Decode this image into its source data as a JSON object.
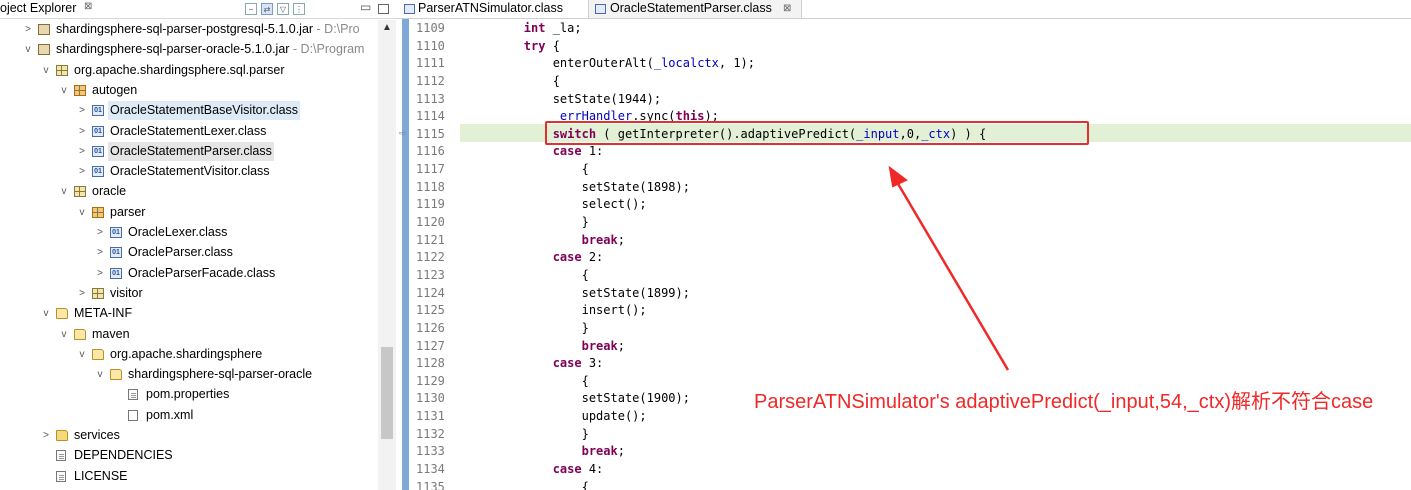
{
  "project_explorer": {
    "title": "oject Explorer",
    "close": "⊠",
    "toolbar": [
      "collapse-all",
      "link-with-editor",
      "filter",
      "view-menu"
    ],
    "tree": [
      {
        "label": "shardingsphere-sql-parser-postgresql-5.1.0.jar",
        "decoration": " - D:\\Pro",
        "icon": "jar-icon",
        "twisty": ">",
        "indent": 0
      },
      {
        "label": "shardingsphere-sql-parser-oracle-5.1.0.jar",
        "decoration": " - D:\\Program",
        "icon": "jar-icon",
        "twisty": "v",
        "indent": 0
      },
      {
        "label": "org.apache.shardingsphere.sql.parser",
        "decoration": "",
        "icon": "package-icon",
        "twisty": "v",
        "indent": 1
      },
      {
        "label": "autogen",
        "decoration": "",
        "icon": "package-brown-icon",
        "twisty": "v",
        "indent": 2
      },
      {
        "label": "OracleStatementBaseVisitor.class",
        "decoration": "",
        "icon": "class-file-icon",
        "twisty": ">",
        "indent": 3,
        "state": "hover"
      },
      {
        "label": "OracleStatementLexer.class",
        "decoration": "",
        "icon": "class-file-icon",
        "twisty": ">",
        "indent": 3
      },
      {
        "label": "OracleStatementParser.class",
        "decoration": "",
        "icon": "class-file-icon",
        "twisty": ">",
        "indent": 3,
        "state": "selected"
      },
      {
        "label": "OracleStatementVisitor.class",
        "decoration": "",
        "icon": "class-file-icon",
        "twisty": ">",
        "indent": 3
      },
      {
        "label": "oracle",
        "decoration": "",
        "icon": "package-icon",
        "twisty": "v",
        "indent": 2
      },
      {
        "label": "parser",
        "decoration": "",
        "icon": "package-brown-icon",
        "twisty": "v",
        "indent": 3
      },
      {
        "label": "OracleLexer.class",
        "decoration": "",
        "icon": "class-file-icon",
        "twisty": ">",
        "indent": 4
      },
      {
        "label": "OracleParser.class",
        "decoration": "",
        "icon": "class-file-icon",
        "twisty": ">",
        "indent": 4
      },
      {
        "label": "OracleParserFacade.class",
        "decoration": "",
        "icon": "class-file-icon",
        "twisty": ">",
        "indent": 4
      },
      {
        "label": "visitor",
        "decoration": "",
        "icon": "package-icon",
        "twisty": ">",
        "indent": 3
      },
      {
        "label": "META-INF",
        "decoration": "",
        "icon": "folder-open-icon",
        "twisty": "v",
        "indent": 1
      },
      {
        "label": "maven",
        "decoration": "",
        "icon": "folder-open-icon",
        "twisty": "v",
        "indent": 2
      },
      {
        "label": "org.apache.shardingsphere",
        "decoration": "",
        "icon": "folder-open-icon",
        "twisty": "v",
        "indent": 3
      },
      {
        "label": "shardingsphere-sql-parser-oracle",
        "decoration": "",
        "icon": "folder-open-icon",
        "twisty": "v",
        "indent": 4
      },
      {
        "label": "pom.properties",
        "decoration": "",
        "icon": "file-icon",
        "twisty": "",
        "indent": 5
      },
      {
        "label": "pom.xml",
        "decoration": "",
        "icon": "xml-file-icon",
        "twisty": "",
        "indent": 5
      },
      {
        "label": "services",
        "decoration": "",
        "icon": "folder-icon",
        "twisty": ">",
        "indent": 1
      },
      {
        "label": "DEPENDENCIES",
        "decoration": "",
        "icon": "file-icon",
        "twisty": "",
        "indent": 1
      },
      {
        "label": "LICENSE",
        "decoration": "",
        "icon": "file-icon",
        "twisty": "",
        "indent": 1
      }
    ]
  },
  "editor": {
    "tabs": [
      {
        "label": "ParserATNSimulator.class",
        "active": false
      },
      {
        "label": "OracleStatementParser.class",
        "active": true,
        "close": "⊠"
      }
    ],
    "current_line": "1115",
    "lines": [
      {
        "n": "1109",
        "code": [
          [
            "        ",
            ""
          ],
          [
            "int",
            "kw"
          ],
          [
            " _la;",
            ""
          ]
        ]
      },
      {
        "n": "1110",
        "code": [
          [
            "        ",
            ""
          ],
          [
            "try",
            "kw"
          ],
          [
            " {",
            ""
          ]
        ]
      },
      {
        "n": "1111",
        "code": [
          [
            "            enterOuterAlt(",
            ""
          ],
          [
            "_localctx",
            "fld"
          ],
          [
            ", 1);",
            ""
          ]
        ]
      },
      {
        "n": "1112",
        "code": [
          [
            "            {",
            ""
          ]
        ]
      },
      {
        "n": "1113",
        "code": [
          [
            "            setState(1944);",
            ""
          ]
        ]
      },
      {
        "n": "1114",
        "code": [
          [
            "            ",
            ""
          ],
          [
            "_errHandler",
            "fld"
          ],
          [
            ".sync(",
            ""
          ],
          [
            "this",
            "kw"
          ],
          [
            ");",
            ""
          ]
        ]
      },
      {
        "n": "1115",
        "code": [
          [
            "            ",
            ""
          ],
          [
            "switch",
            "kw"
          ],
          [
            " ( getInterpreter().adaptivePredict(",
            ""
          ],
          [
            "_input",
            "fld"
          ],
          [
            ",0,",
            ""
          ],
          [
            "_ctx",
            "fld"
          ],
          [
            ") ) {",
            ""
          ]
        ]
      },
      {
        "n": "1116",
        "code": [
          [
            "            ",
            ""
          ],
          [
            "case",
            "kw"
          ],
          [
            " 1:",
            ""
          ]
        ]
      },
      {
        "n": "1117",
        "code": [
          [
            "                {",
            ""
          ]
        ]
      },
      {
        "n": "1118",
        "code": [
          [
            "                setState(1898);",
            ""
          ]
        ]
      },
      {
        "n": "1119",
        "code": [
          [
            "                select();",
            ""
          ]
        ]
      },
      {
        "n": "1120",
        "code": [
          [
            "                }",
            ""
          ]
        ]
      },
      {
        "n": "1121",
        "code": [
          [
            "                ",
            ""
          ],
          [
            "break",
            "kw"
          ],
          [
            ";",
            ""
          ]
        ]
      },
      {
        "n": "1122",
        "code": [
          [
            "            ",
            ""
          ],
          [
            "case",
            "kw"
          ],
          [
            " 2:",
            ""
          ]
        ]
      },
      {
        "n": "1123",
        "code": [
          [
            "                {",
            ""
          ]
        ]
      },
      {
        "n": "1124",
        "code": [
          [
            "                setState(1899);",
            ""
          ]
        ]
      },
      {
        "n": "1125",
        "code": [
          [
            "                insert();",
            ""
          ]
        ]
      },
      {
        "n": "1126",
        "code": [
          [
            "                }",
            ""
          ]
        ]
      },
      {
        "n": "1127",
        "code": [
          [
            "                ",
            ""
          ],
          [
            "break",
            "kw"
          ],
          [
            ";",
            ""
          ]
        ]
      },
      {
        "n": "1128",
        "code": [
          [
            "            ",
            ""
          ],
          [
            "case",
            "kw"
          ],
          [
            " 3:",
            ""
          ]
        ]
      },
      {
        "n": "1129",
        "code": [
          [
            "                {",
            ""
          ]
        ]
      },
      {
        "n": "1130",
        "code": [
          [
            "                setState(1900);",
            ""
          ]
        ]
      },
      {
        "n": "1131",
        "code": [
          [
            "                update();",
            ""
          ]
        ]
      },
      {
        "n": "1132",
        "code": [
          [
            "                }",
            ""
          ]
        ]
      },
      {
        "n": "1133",
        "code": [
          [
            "                ",
            ""
          ],
          [
            "break",
            "kw"
          ],
          [
            ";",
            ""
          ]
        ]
      },
      {
        "n": "1134",
        "code": [
          [
            "            ",
            ""
          ],
          [
            "case",
            "kw"
          ],
          [
            " 4:",
            ""
          ]
        ]
      },
      {
        "n": "1135",
        "code": [
          [
            "                {",
            ""
          ]
        ]
      }
    ]
  },
  "annotation": {
    "text": "ParserATNSimulator's adaptivePredict(_input,54,_ctx)解析不符合case",
    "color": "#f02828"
  },
  "colors": {
    "keyword": "#7f0055",
    "field": "#0000c0",
    "line_number": "#7a7a7a",
    "current_line": "#e2f0d6",
    "selection": "#e5e5e5"
  }
}
